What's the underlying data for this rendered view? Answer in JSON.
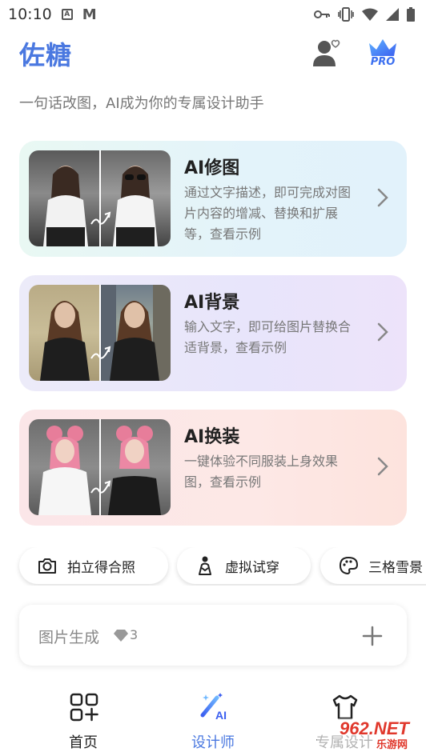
{
  "status_bar": {
    "time": "10:10",
    "notif_a": "A",
    "notif_m": "M"
  },
  "header": {
    "app_title": "佐糖",
    "pro_badge": "PRO"
  },
  "tagline": "一句话改图，AI成为你的专属设计助手",
  "feature_cards": [
    {
      "title": "AI修图",
      "description": "通过文字描述，即可完成对图片内容的增减、替换和扩展等，查看示例"
    },
    {
      "title": "AI背景",
      "description": "输入文字，即可给图片替换合适背景，查看示例"
    },
    {
      "title": "AI换装",
      "description": "一键体验不同服装上身效果图，查看示例"
    }
  ],
  "chips": [
    {
      "label": "拍立得合照",
      "icon": "camera-icon"
    },
    {
      "label": "虚拟试穿",
      "icon": "person-hanger-icon"
    },
    {
      "label": "三格雪景",
      "icon": "palette-icon"
    }
  ],
  "image_generation": {
    "label": "图片生成",
    "count": "3",
    "icon": "gem-icon"
  },
  "bottom_nav": [
    {
      "label": "首页",
      "icon": "home-grid-icon"
    },
    {
      "label": "设计师",
      "icon": "ai-magic-wand-icon",
      "active": true
    },
    {
      "label": "专属设计",
      "icon": "tshirt-icon"
    }
  ],
  "watermark": {
    "main": "962.NET",
    "sub": "乐游网"
  },
  "colors": {
    "accent": "#4a78e0",
    "card1_bg": "#e5f5f6",
    "card2_bg": "#eae6fa",
    "card3_bg": "#fce6e4"
  }
}
